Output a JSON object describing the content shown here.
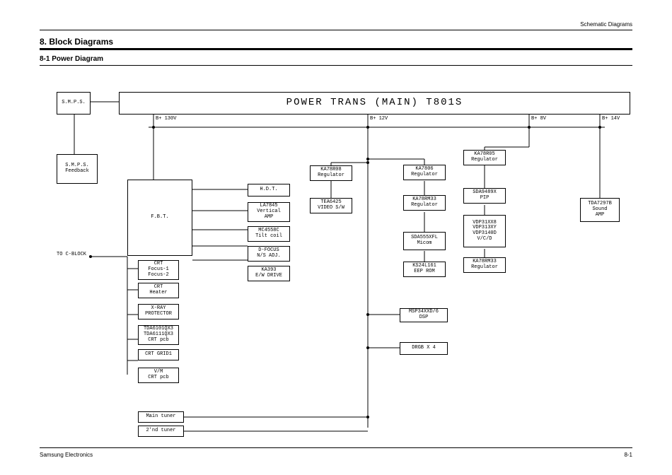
{
  "header_right": "Schematic Diagrams",
  "section_title": "8. Block Diagrams",
  "sub_title": "8-1 Power Diagram",
  "footer_left": "Samsung Electronics",
  "footer_right": "8-1",
  "power_trans": "POWER TRANS (MAIN) T801S",
  "rails": {
    "b130v": "B+ 130V",
    "b12v": "B+ 12V",
    "b8v": "B+ 8V",
    "b14v": "B+ 14V"
  },
  "to_cblock": "TO C-BLOCK",
  "blocks": {
    "smps": "S.M.P.S.",
    "smps_fb": "S.M.P.S.\nFeedback",
    "fbt": "F.B.T.",
    "hdt": "H.D.T.",
    "la7845": "LA7845\nVertical\nAMP",
    "mc4558c": "MC4558C\nTilt coil",
    "dfocus": "D-FOCUS\nN/S ADJ.",
    "ka393": "KA393\nE/W DRIVE",
    "crt_f1": "CRT\nFocus-1\nFocus-2",
    "crt_heater": "CRT\nHeater",
    "xray": "X-RAY\nPROTECTOR",
    "tda6101": "TDA6101QX3\nTDA6111QX3\nCRT pcb",
    "crt_grid1": "CRT GRID1",
    "vm_crt": "V/M\nCRT pcb",
    "main_tuner": "Main tuner",
    "second_tuner": "2'nd tuner",
    "ka78r08": "KA78R08\nRegulator",
    "tea6425": "TEA6425\nVIDEO S/W",
    "ka7806": "KA7806\nRegulator",
    "ka78rm33a": "KA78RM33\nRegulator",
    "sda555": "SDA555XFL\nMicom",
    "ks24l161": "KS24L161\nEEP ROM",
    "msp34": "MSP34XXD/6\nDSP",
    "drgb": "DRGB X 4",
    "ka78r05": "KA78R05\nRegulator",
    "sda9489": "SDA9489X\nPIP",
    "vdp31": "VDP31XX8\nVDP313XY\nVDP3140D\nV/C/D",
    "ka78rm33b": "KA78RM33\nRegulator",
    "tda7297": "TDA7297B\nSound\nAMP"
  }
}
